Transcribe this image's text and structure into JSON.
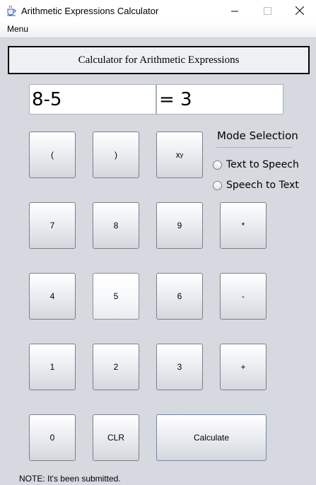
{
  "window": {
    "title": "Arithmetic Expressions Calculator",
    "icon": "java-cup-icon",
    "controls": {
      "minimize": "minimize-icon",
      "maximize": "maximize-icon",
      "close": "close-icon"
    }
  },
  "menubar": {
    "menu_label": "Menu"
  },
  "header": {
    "title": "Calculator for Arithmetic Expressions"
  },
  "display": {
    "expression": "8-5",
    "result": "= 3"
  },
  "buttons": {
    "open_paren": "(",
    "close_paren": ")",
    "power_base": "x",
    "power_exp": "y",
    "seven": "7",
    "eight": "8",
    "nine": "9",
    "multiply": "*",
    "four": "4",
    "five": "5",
    "six": "6",
    "minus": "-",
    "one": "1",
    "two": "2",
    "three": "3",
    "plus": "+",
    "zero": "0",
    "clear": "CLR",
    "calculate": "Calculate"
  },
  "mode": {
    "title": "Mode Selection",
    "options": [
      {
        "label": "Text to Speech",
        "selected": false
      },
      {
        "label": "Speech to Text",
        "selected": false
      }
    ]
  },
  "note": "NOTE: It's been submitted.",
  "colors": {
    "background": "#d6d9df",
    "accent_border": "#6b89b3"
  }
}
